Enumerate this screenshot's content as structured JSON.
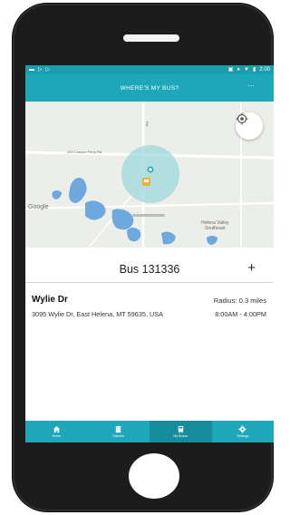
{
  "status_bar": {
    "time": "2:00",
    "left_icons": [
      "cast-icon",
      "play-icon",
      "play-icon"
    ],
    "right_icons": [
      "nfc-icon",
      "location-icon",
      "wifi-icon",
      "battery-icon"
    ]
  },
  "app_bar": {
    "title": "WHERE'S MY BUS?",
    "overflow": "⋯"
  },
  "map": {
    "google": "Google",
    "road_label": "430  Canyon Ferry Rd",
    "highway_label": "430",
    "road_vertical": "Rd",
    "place": "Helena Valley\nSoutheast",
    "place_line1": "Helena Valley",
    "place_line2": "Southeast"
  },
  "bus": {
    "title": "Bus 131336",
    "add": "+"
  },
  "stop": {
    "name": "Wylie Dr",
    "address": "3095 Wylie Dr, East Helena, MT 59635, USA",
    "radius": "Radius: 0.3 miles",
    "hours": "8:00AM - 4:00PM"
  },
  "nav": [
    {
      "label": "Home",
      "icon": "home-icon",
      "active": false
    },
    {
      "label": "Districts",
      "icon": "district-icon",
      "active": false
    },
    {
      "label": "My Buses",
      "icon": "bus-icon",
      "active": true
    },
    {
      "label": "Settings",
      "icon": "gear-icon",
      "active": false
    }
  ],
  "colors": {
    "primary": "#1ea7b8",
    "primary_dark": "#158d9c",
    "geofence": "#9fd8db",
    "water": "#6fa8dc"
  }
}
